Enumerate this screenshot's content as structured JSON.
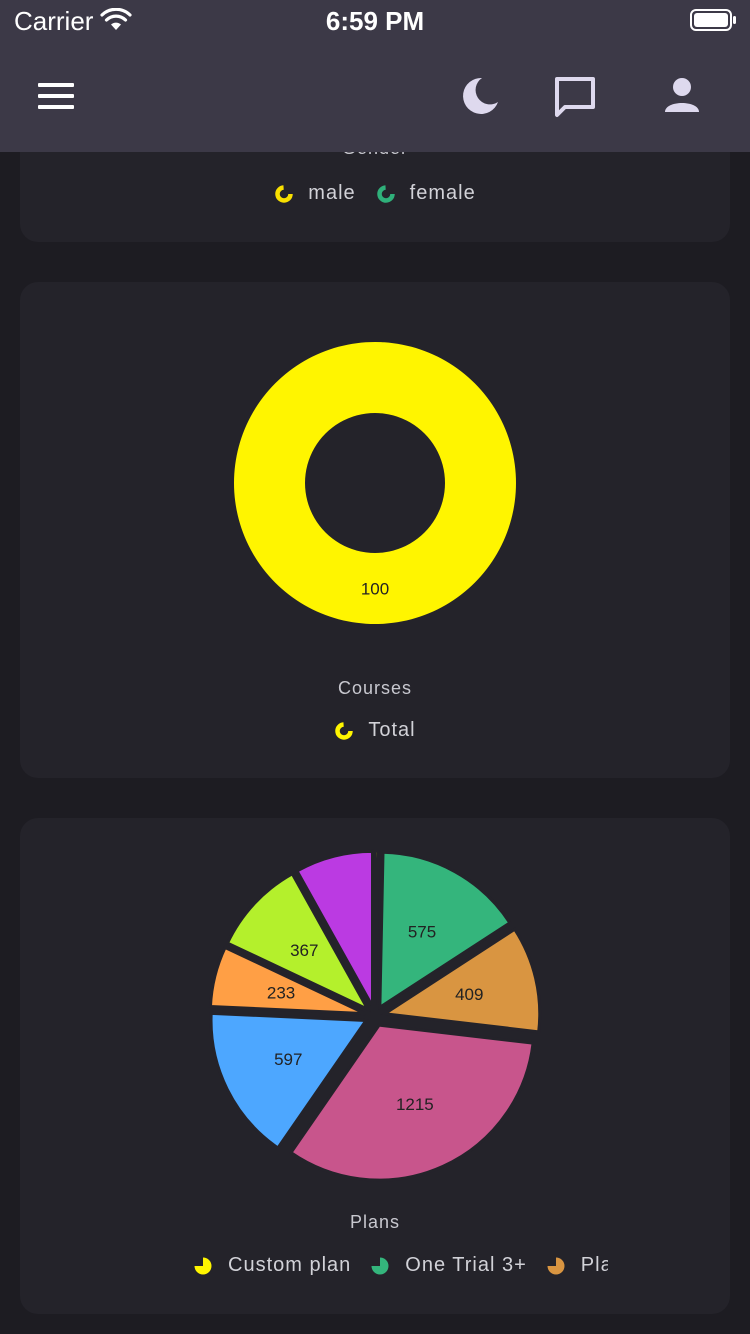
{
  "status_bar": {
    "carrier": "Carrier",
    "time": "6:59 PM"
  },
  "app_bar": {
    "menu_icon": "hamburger-menu-icon",
    "actions": [
      "moon-icon",
      "chat-icon",
      "person-icon"
    ]
  },
  "gender_card": {
    "label": "Gender",
    "legend": [
      {
        "label": "male",
        "color": "#f9e000"
      },
      {
        "label": "female",
        "color": "#2fb07a"
      }
    ]
  },
  "courses_card": {
    "label": "Courses",
    "legend": [
      {
        "label": "Total",
        "color": "#fff500"
      }
    ]
  },
  "plans_card": {
    "label": "Plans",
    "legend": [
      {
        "label": "Custom plan",
        "color": "#fff500"
      },
      {
        "label": "One Trial 3+",
        "color": "#34b57c"
      },
      {
        "label": "Pla",
        "color": "#d99541"
      }
    ]
  },
  "chart_data": [
    {
      "type": "donut",
      "title": "Courses",
      "categories": [
        "Total"
      ],
      "values": [
        100
      ],
      "colors": [
        "#fff500"
      ]
    },
    {
      "type": "pie",
      "title": "Plans",
      "slices": [
        {
          "value": 12,
          "color": "#fff500",
          "label": ""
        },
        {
          "value": 575,
          "color": "#34b57c",
          "label": "575"
        },
        {
          "value": 409,
          "color": "#d99541",
          "label": "409"
        },
        {
          "value": 1215,
          "color": "#c8558c",
          "label": "1215"
        },
        {
          "value": 597,
          "color": "#4da7ff",
          "label": "597"
        },
        {
          "value": 233,
          "color": "#ff9f45",
          "label": "233"
        },
        {
          "value": 367,
          "color": "#b4f02c",
          "label": "367"
        },
        {
          "value": 300,
          "color": "#bb3ae2",
          "label": ""
        }
      ]
    }
  ]
}
